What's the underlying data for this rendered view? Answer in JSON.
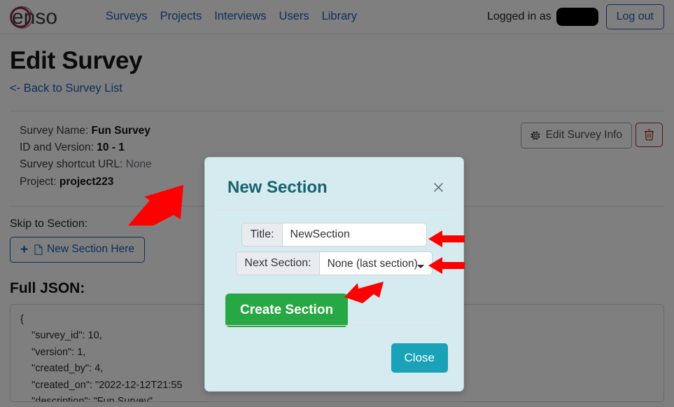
{
  "navbar": {
    "brand_text": "enso",
    "brand_icon": "enso-circle-logo",
    "links": [
      {
        "label": "Surveys"
      },
      {
        "label": "Projects"
      },
      {
        "label": "Interviews"
      },
      {
        "label": "Users"
      },
      {
        "label": "Library"
      }
    ],
    "logged_in_text": "Logged in as",
    "username_redacted": "",
    "logout_label": "Log out"
  },
  "page": {
    "title": "Edit Survey",
    "back_link": "<- Back to Survey List"
  },
  "survey_info": {
    "name_label": "Survey Name:",
    "name_value": "Fun Survey",
    "id_label": "ID and Version:",
    "id_value": "10 - 1",
    "shortcut_label": "Survey shortcut URL:",
    "shortcut_value": "None",
    "project_label": "Project:",
    "project_value": "project223",
    "edit_button_label": "Edit Survey Info",
    "edit_button_icon": "gear-icon",
    "delete_button_icon": "trash-icon"
  },
  "sections": {
    "skip_label": "Skip to Section:",
    "new_section_button_label": "New Section Here",
    "new_section_plus": "+",
    "new_section_icon": "document-icon"
  },
  "json_panel": {
    "title": "Full JSON:",
    "content": "{\n    \"survey_id\": 10,\n    \"version\": 1,\n    \"created_by\": 4,\n    \"created_on\": \"2022-12-12T21:55\n    \"description\": \"Fun Survey\","
  },
  "modal": {
    "title": "New Section",
    "close_x_icon": "close-icon",
    "title_field": {
      "label": "Title:",
      "value": "NewSection",
      "placeholder": ""
    },
    "next_section_field": {
      "label": "Next Section:",
      "selected": "None (last section)",
      "options": [
        "None (last section)"
      ]
    },
    "create_button_label": "Create Section",
    "close_button_label": "Close"
  },
  "annotations": {
    "arrow_color": "#FF0000",
    "arrows": [
      {
        "name": "arrow-to-new-section-here",
        "direction": "down-left"
      },
      {
        "name": "arrow-to-title-field",
        "direction": "left"
      },
      {
        "name": "arrow-to-next-section-field",
        "direction": "left"
      },
      {
        "name": "arrow-to-create-section-button",
        "direction": "down-left"
      }
    ]
  },
  "colors": {
    "nav_link": "#1a5fb4",
    "modal_bg": "#d5ebef",
    "modal_title": "#18626f",
    "create_button": "#28a745",
    "close_button": "#19a2b8",
    "danger": "#a51f17",
    "brand": "#8c2749"
  }
}
